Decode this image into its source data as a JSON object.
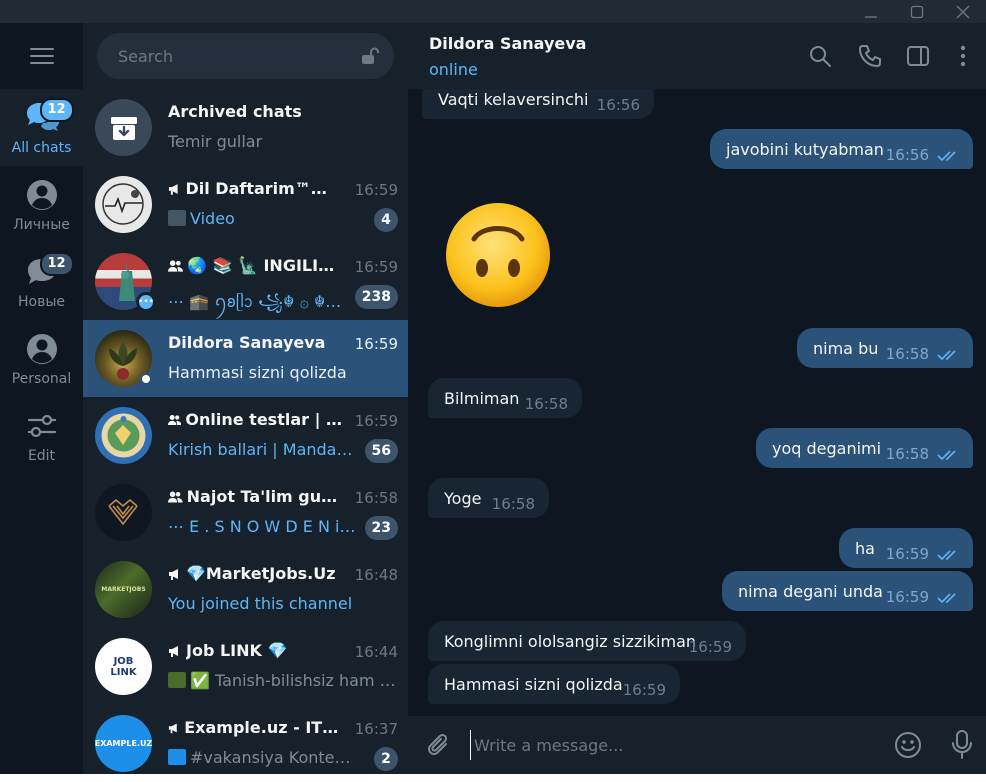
{
  "window": {
    "controls": [
      "minimize",
      "maximize",
      "close"
    ]
  },
  "folders": [
    {
      "label": "All chats",
      "badge": "12",
      "active": true,
      "icon": "chats-icon"
    },
    {
      "label": "Личные",
      "badge": "",
      "active": false,
      "icon": "person-icon"
    },
    {
      "label": "Новые",
      "badge": "12",
      "active": false,
      "icon": "chat-bubble-icon"
    },
    {
      "label": "Personal",
      "badge": "",
      "active": false,
      "icon": "person-icon"
    },
    {
      "label": "Edit",
      "badge": "",
      "active": false,
      "icon": "sliders-icon"
    }
  ],
  "search": {
    "placeholder": "Search"
  },
  "chats": [
    {
      "name": "Archived chats",
      "preview": "Temir gullar",
      "time": "",
      "badge": ""
    },
    {
      "name": "Dil Daftarim™🩹...",
      "preview": "Video",
      "time": "16:59",
      "badge": "4"
    },
    {
      "name": "🌏 📚 🗽 INGILIZ ...",
      "preview": "⋯ 🕋 ꪆ𐐪ᥫᩣ ꧁☬ ۞ ☬꧂ ...",
      "time": "16:59",
      "badge": "238"
    },
    {
      "name": "Dildora Sanayeva",
      "preview": "Hammasi sizni qolizda",
      "time": "16:59",
      "badge": ""
    },
    {
      "name": "Online testlar | Abi...",
      "preview": "Kirish ballari | Mandatl...",
      "time": "16:59",
      "badge": "56"
    },
    {
      "name": "Najot Ta'lim guruhi",
      "preview": "⋯ E . S N O W D E N is t...",
      "time": "16:58",
      "badge": "23"
    },
    {
      "name": "💎MarketJobs.Uz",
      "preview": "You joined this channel",
      "time": "16:48",
      "badge": ""
    },
    {
      "name": "Job LINK 💎",
      "preview": "✅ Tanish-bilishsiz ham i...",
      "time": "16:44",
      "badge": ""
    },
    {
      "name": "Example.uz - IT Jobs",
      "preview": "#vakansiya  Kontent ...",
      "time": "16:37",
      "badge": "2"
    }
  ],
  "avatar_text": {
    "job_link": "JOB LINK",
    "example": "EXAMPLE.UZ",
    "marketjobs": "MARKETJOBS"
  },
  "header": {
    "title": "Dildora Sanayeva",
    "status": "online"
  },
  "messages": [
    {
      "text": "Vaqti kelaversinchi",
      "time": "16:56",
      "dir": "in"
    },
    {
      "text": "javobini kutyabman",
      "time": "16:56",
      "dir": "out"
    },
    {
      "text": "🙃",
      "time": "",
      "dir": "sticker"
    },
    {
      "text": "nima bu",
      "time": "16:58",
      "dir": "out"
    },
    {
      "text": "Bilmiman",
      "time": "16:58",
      "dir": "in"
    },
    {
      "text": "yoq deganimi",
      "time": "16:58",
      "dir": "out"
    },
    {
      "text": "Yoge",
      "time": "16:58",
      "dir": "in"
    },
    {
      "text": "ha",
      "time": "16:59",
      "dir": "out"
    },
    {
      "text": "nima degani unda",
      "time": "16:59",
      "dir": "out"
    },
    {
      "text": "Konglimni ololsangiz sizzikiman",
      "time": "16:59",
      "dir": "in"
    },
    {
      "text": "Hammasi sizni qolizda",
      "time": "16:59",
      "dir": "in"
    }
  ],
  "composer": {
    "placeholder": "Write a message..."
  },
  "colors": {
    "accent": "#5eb5f7",
    "active_chat": "#2b5278",
    "sidebar": "#17212b",
    "background": "#0e1621"
  }
}
